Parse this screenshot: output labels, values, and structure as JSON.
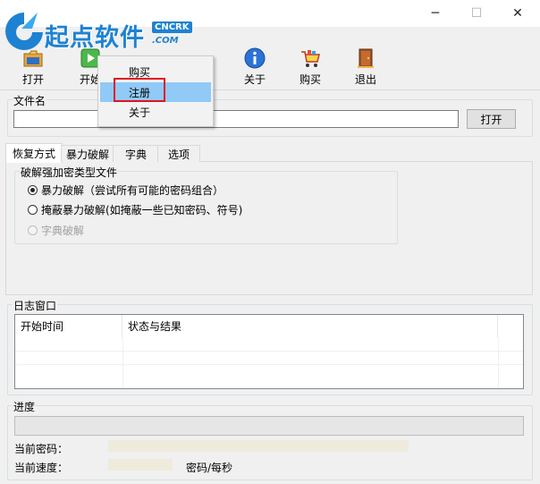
{
  "window": {
    "title_partial": "",
    "controls": {
      "minimize": "─",
      "maximize": "☐",
      "close": "✕"
    }
  },
  "watermark": {
    "logo_text": "起点软件",
    "badge": "CNCRK",
    "badge2": ".COM"
  },
  "toolbar": {
    "open_label": "打开",
    "start_label": "开始",
    "about_label": "关于",
    "buy_label": "购买",
    "exit_label": "退出"
  },
  "menu": {
    "items": [
      {
        "label": "购买"
      },
      {
        "label": "注册"
      },
      {
        "label": "关于"
      }
    ],
    "highlighted": "注册"
  },
  "file": {
    "group_label": "文件名",
    "value": "",
    "open_button": "打开"
  },
  "tabs": [
    {
      "label": "恢复方式",
      "active": true
    },
    {
      "label": "暴力破解"
    },
    {
      "label": "字典"
    },
    {
      "label": "选项"
    }
  ],
  "recovery": {
    "group_label": "破解强加密类型文件",
    "options": [
      {
        "label": "暴力破解（尝试所有可能的密码组合）",
        "checked": true,
        "enabled": true
      },
      {
        "label": "掩蔽暴力破解(如掩蔽一些已知密码、符号)",
        "checked": false,
        "enabled": true
      },
      {
        "label": "字典破解",
        "checked": false,
        "enabled": false
      }
    ]
  },
  "log": {
    "group_label": "日志窗口",
    "columns": [
      "开始时间",
      "状态与结果"
    ]
  },
  "progress": {
    "group_label": "进度",
    "value": 0,
    "current_password_label": "当前密码：",
    "current_password_value": "",
    "current_speed_label": "当前速度：",
    "current_speed_value": "",
    "speed_unit": "密码/每秒"
  },
  "colors": {
    "menu_highlight": "#91c9f7",
    "annotation_box": "#e0141e",
    "logo_blue": "#1e82d2"
  }
}
